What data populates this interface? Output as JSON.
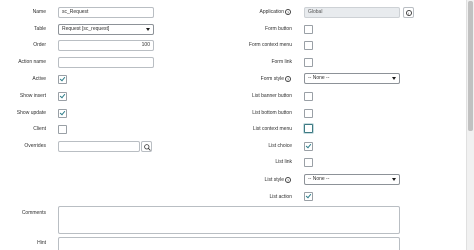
{
  "left": {
    "name": {
      "label": "Name",
      "value": "sc_Request"
    },
    "table": {
      "label": "Table",
      "value": "Request [sc_request]"
    },
    "order": {
      "label": "Order",
      "value": "100"
    },
    "action_name": {
      "label": "Action name",
      "value": ""
    },
    "active": {
      "label": "Active",
      "checked": true
    },
    "show_insert": {
      "label": "Show insert",
      "checked": true
    },
    "show_update": {
      "label": "Show update",
      "checked": true
    },
    "client": {
      "label": "Client",
      "checked": false
    },
    "overrides": {
      "label": "Overrides",
      "value": ""
    }
  },
  "right": {
    "application": {
      "label": "Application",
      "value": "Global"
    },
    "form_button": {
      "label": "Form button",
      "checked": false
    },
    "form_context_menu": {
      "label": "Form context menu",
      "checked": false
    },
    "form_link": {
      "label": "Form link",
      "checked": false
    },
    "form_style": {
      "label": "Form style",
      "value": "-- None --"
    },
    "list_banner_button": {
      "label": "List banner button",
      "checked": false
    },
    "list_bottom_button": {
      "label": "List bottom button",
      "checked": false
    },
    "list_context_menu": {
      "label": "List context menu",
      "checked": false
    },
    "list_choice": {
      "label": "List choice",
      "checked": true
    },
    "list_link": {
      "label": "List link",
      "checked": false
    },
    "list_style": {
      "label": "List style",
      "value": "-- None --"
    },
    "list_action": {
      "label": "List action",
      "checked": true
    }
  },
  "bottom": {
    "comments": {
      "label": "Comments",
      "value": ""
    },
    "hint": {
      "label": "Hint",
      "value": ""
    }
  },
  "icons": {
    "help": "?",
    "info": "i",
    "search": "search-icon"
  }
}
